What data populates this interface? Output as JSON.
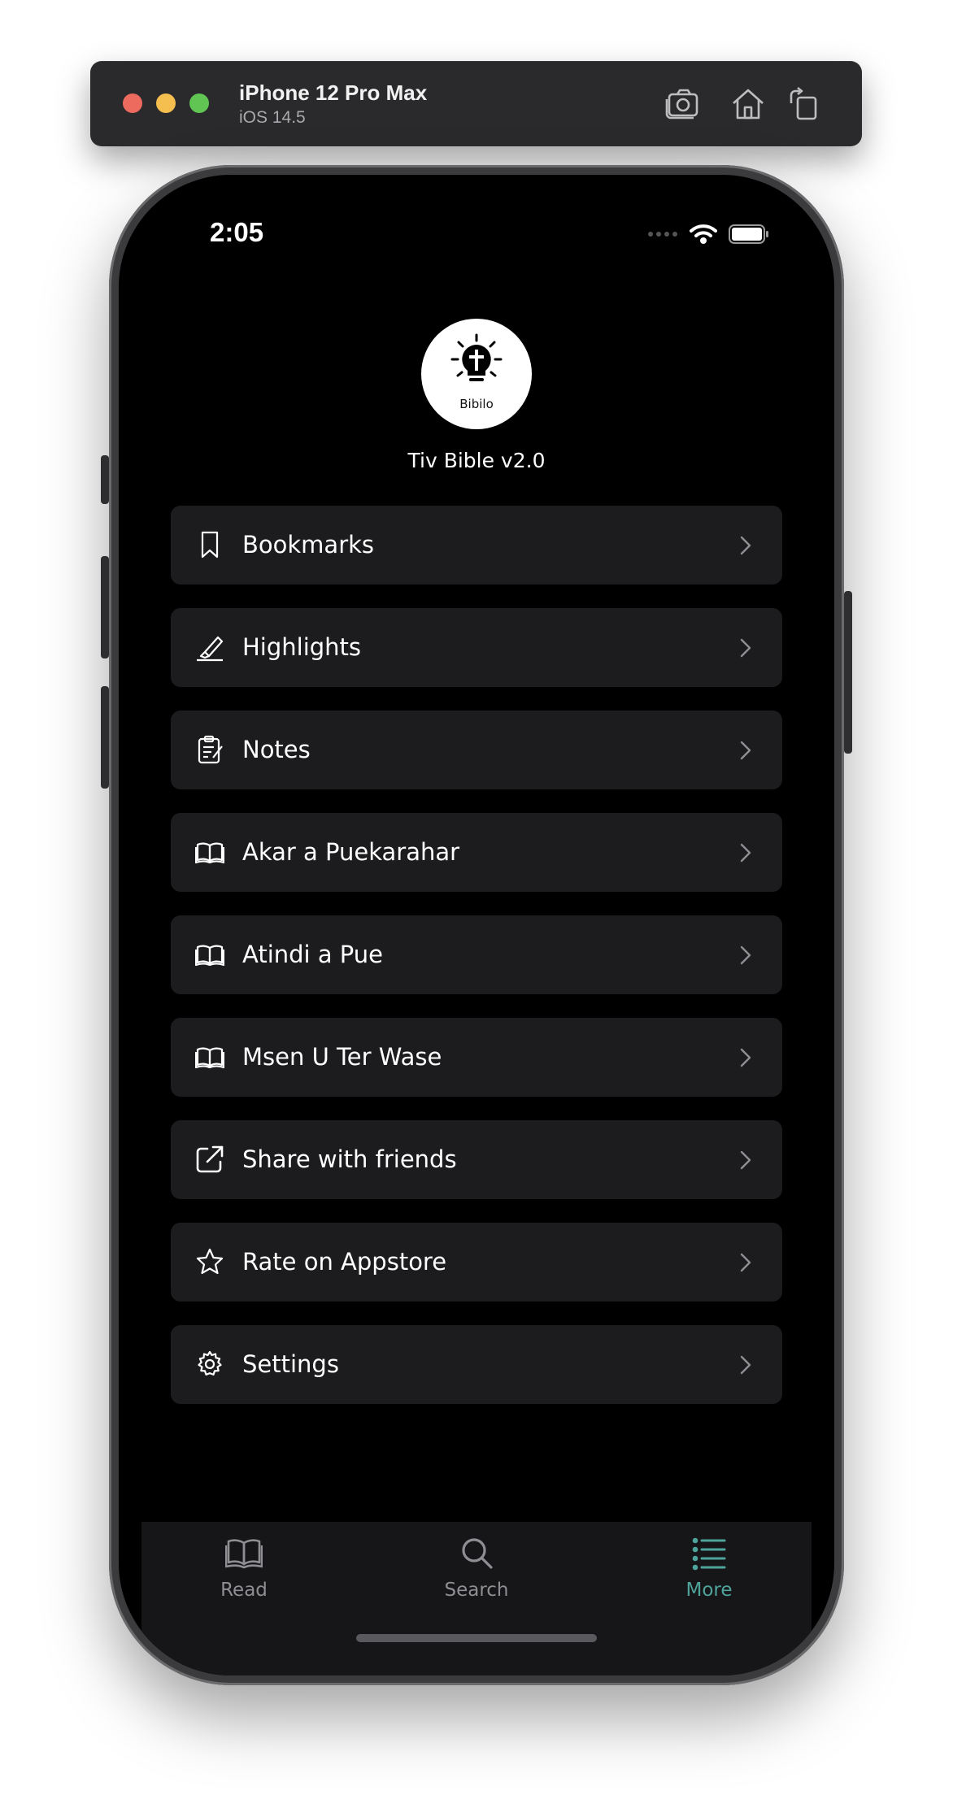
{
  "simulator": {
    "device_name": "iPhone 12 Pro Max",
    "os_version": "iOS 14.5",
    "icons": [
      "screenshot-icon",
      "home-icon",
      "rotate-icon"
    ]
  },
  "status_bar": {
    "time": "2:05"
  },
  "header": {
    "logo_text": "Bibilo",
    "app_version": "Tiv Bible v2.0"
  },
  "menu": {
    "items": [
      {
        "label": "Bookmarks",
        "icon": "bookmark-icon"
      },
      {
        "label": "Highlights",
        "icon": "highlighter-icon"
      },
      {
        "label": "Notes",
        "icon": "notes-icon"
      },
      {
        "label": "Akar a Puekarahar",
        "icon": "book-icon"
      },
      {
        "label": "Atindi a Pue",
        "icon": "book-icon"
      },
      {
        "label": "Msen U Ter Wase",
        "icon": "book-icon"
      },
      {
        "label": "Share with friends",
        "icon": "share-icon"
      },
      {
        "label": "Rate on Appstore",
        "icon": "star-icon"
      },
      {
        "label": "Settings",
        "icon": "gear-icon"
      }
    ]
  },
  "tabbar": {
    "tabs": [
      {
        "label": "Read",
        "icon": "book-icon",
        "active": false
      },
      {
        "label": "Search",
        "icon": "search-icon",
        "active": false
      },
      {
        "label": "More",
        "icon": "list-icon",
        "active": true
      }
    ],
    "active_color": "#4ea39a",
    "inactive_color": "#8e8e93"
  }
}
